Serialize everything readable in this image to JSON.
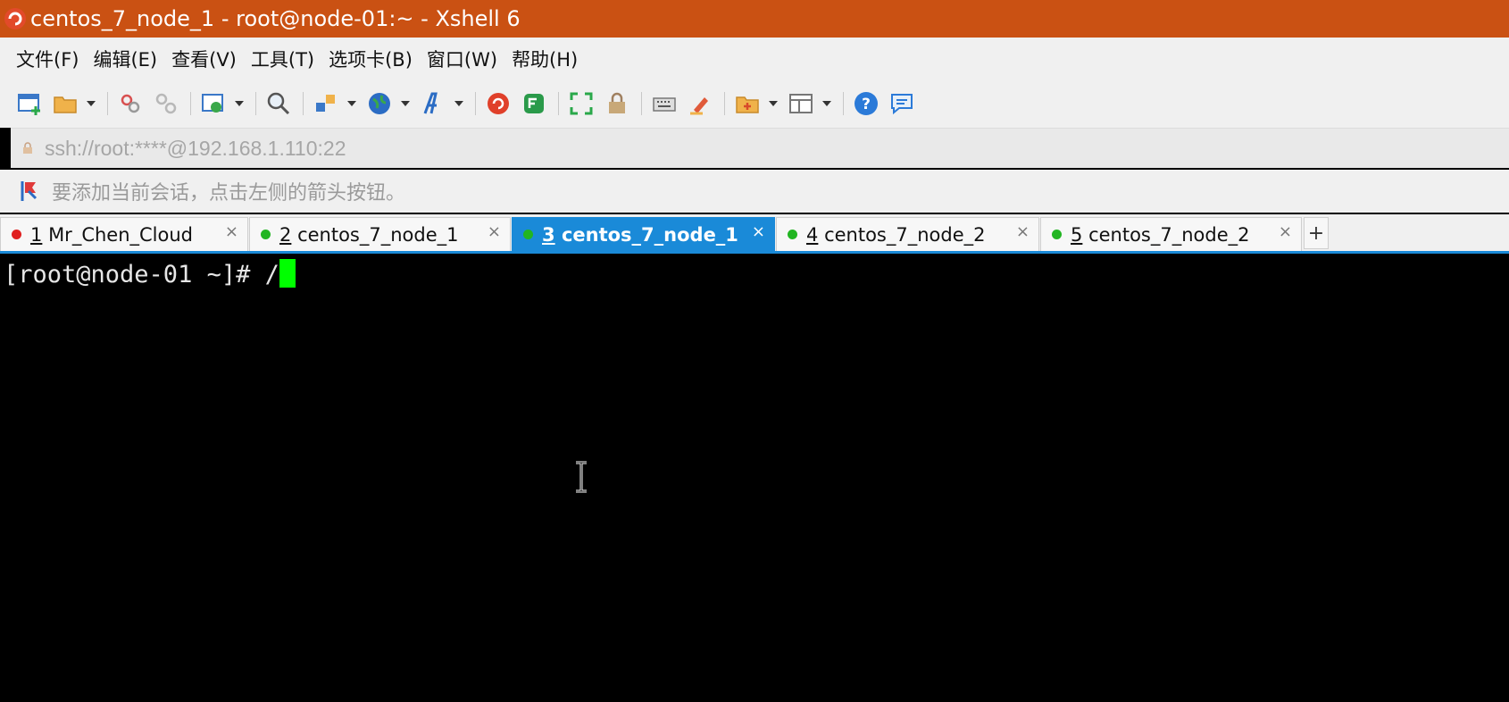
{
  "window": {
    "title": "centos_7_node_1 - root@node-01:~ - Xshell 6",
    "accent": "#ca5113"
  },
  "menu": [
    "文件(F)",
    "编辑(E)",
    "查看(V)",
    "工具(T)",
    "选项卡(B)",
    "窗口(W)",
    "帮助(H)"
  ],
  "toolbar": {
    "icons": [
      "new-session-icon",
      "open-folder-icon",
      "connect-icon",
      "disconnect-icon",
      "properties-icon",
      "find-icon",
      "transfer-icon",
      "globe-icon",
      "font-icon",
      "xshell-icon",
      "xftp-icon",
      "fullscreen-icon",
      "lock-icon",
      "keyboard-icon",
      "highlight-icon",
      "new-tab-folder-icon",
      "layout-icon",
      "help-icon",
      "chat-icon"
    ]
  },
  "address": {
    "value": "ssh://root:****@192.168.1.110:22"
  },
  "hint": {
    "text": "要添加当前会话，点击左侧的箭头按钮。"
  },
  "tabs": [
    {
      "num": "1",
      "name": "Mr_Chen_Cloud",
      "status": "#e02020",
      "active": false
    },
    {
      "num": "2",
      "name": "centos_7_node_1",
      "status": "#22b522",
      "active": false
    },
    {
      "num": "3",
      "name": "centos_7_node_1",
      "status": "#22b522",
      "active": true
    },
    {
      "num": "4",
      "name": "centos_7_node_2",
      "status": "#22b522",
      "active": false
    },
    {
      "num": "5",
      "name": "centos_7_node_2",
      "status": "#22b522",
      "active": false
    }
  ],
  "tab_close": "×",
  "new_tab": "+",
  "terminal": {
    "prompt": "[root@node-01 ~]# /",
    "cursor_color": "#00ff00"
  }
}
